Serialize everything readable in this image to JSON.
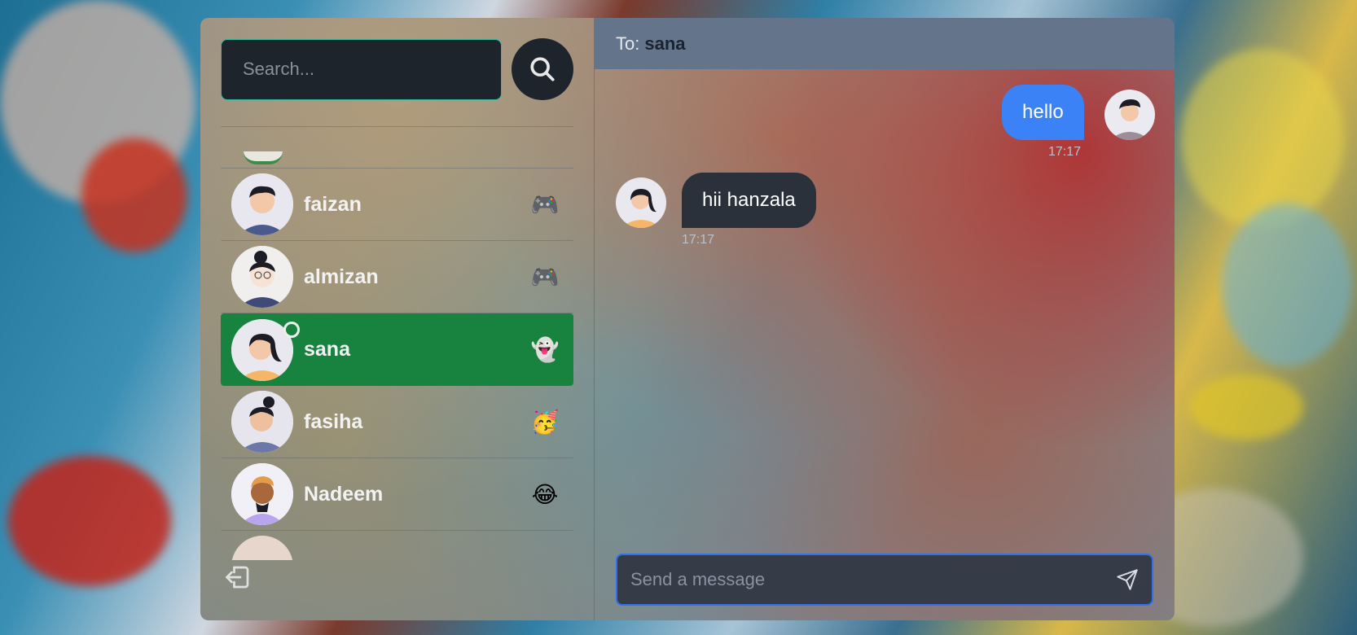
{
  "search": {
    "placeholder": "Search..."
  },
  "contacts": [
    {
      "name": "faizan",
      "emoji": "🎮",
      "active": false
    },
    {
      "name": "almizan",
      "emoji": "🎮",
      "active": false
    },
    {
      "name": "sana",
      "emoji": "👻",
      "active": true,
      "online": true
    },
    {
      "name": "fasiha",
      "emoji": "🥳",
      "active": false
    },
    {
      "name": "Nadeem",
      "emoji": "😂",
      "active": false
    }
  ],
  "chat": {
    "to_label": "To:",
    "to_name": "sana",
    "messages": [
      {
        "text": "hello",
        "time": "17:17",
        "direction": "out"
      },
      {
        "text": "hii hanzala",
        "time": "17:17",
        "direction": "in"
      }
    ],
    "input_placeholder": "Send a message"
  },
  "colors": {
    "active_contact": "#18833e",
    "outgoing_bubble": "#3b82f6",
    "incoming_bubble": "#2b313b",
    "header": "#64748b",
    "input_border": "#2f6ff0"
  }
}
